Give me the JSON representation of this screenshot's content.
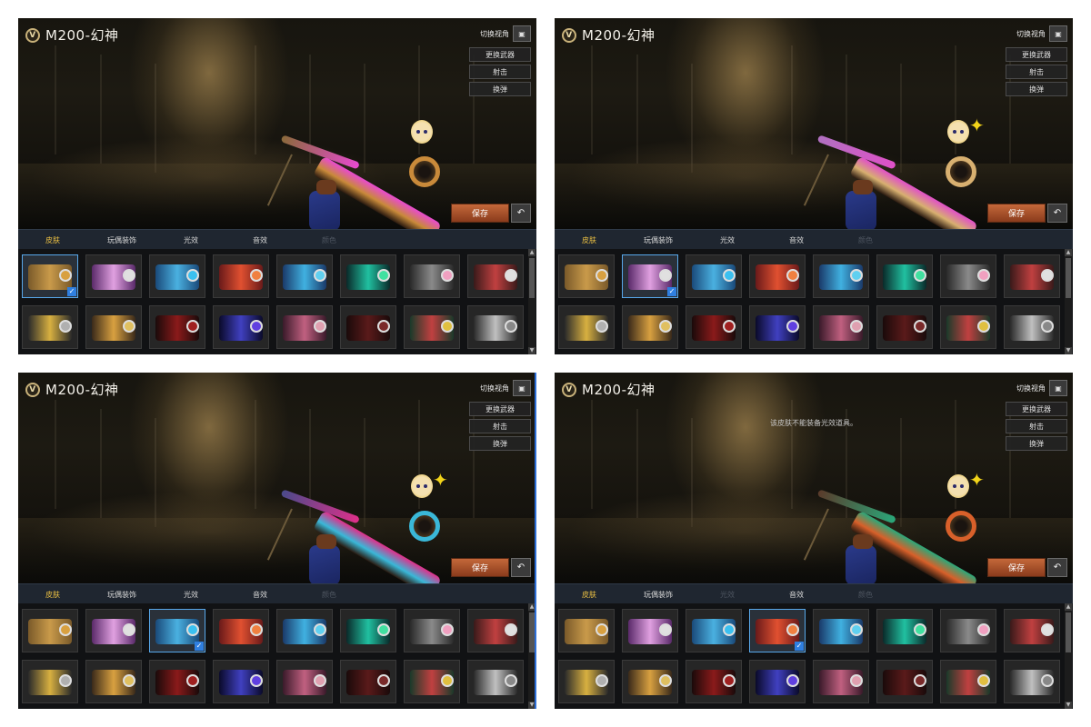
{
  "panels": [
    {
      "title": "M200-幻神",
      "camera_label": "切换视角",
      "camera_icon": "camera-icon",
      "actions": [
        "更换武器",
        "射击",
        "换弹"
      ],
      "save_label": "保存",
      "back_icon": "return-icon",
      "notice": "",
      "tabs": [
        {
          "label": "皮肤",
          "state": "active"
        },
        {
          "label": "玩偶装饰",
          "state": "normal"
        },
        {
          "label": "光效",
          "state": "normal"
        },
        {
          "label": "音效",
          "state": "normal"
        },
        {
          "label": "颜色",
          "state": "disabled"
        }
      ],
      "selected_skin_index": 0,
      "gun_colors": {
        "body": "#c98a3a",
        "accent": "#e84ad0",
        "barrel": "#8a6a3a"
      }
    },
    {
      "title": "M200-幻神",
      "camera_label": "切换视角",
      "camera_icon": "camera-icon",
      "actions": [
        "更换武器",
        "射击",
        "换弹"
      ],
      "save_label": "保存",
      "back_icon": "return-icon",
      "notice": "",
      "tabs": [
        {
          "label": "皮肤",
          "state": "active"
        },
        {
          "label": "玩偶装饰",
          "state": "normal"
        },
        {
          "label": "光效",
          "state": "normal"
        },
        {
          "label": "音效",
          "state": "normal"
        },
        {
          "label": "颜色",
          "state": "disabled"
        }
      ],
      "selected_skin_index": 1,
      "gun_colors": {
        "body": "#d8b070",
        "accent": "#e050c8",
        "barrel": "#b070c0"
      }
    },
    {
      "title": "M200-幻神",
      "camera_label": "切换视角",
      "camera_icon": "camera-icon",
      "actions": [
        "更换武器",
        "射击",
        "换弹"
      ],
      "save_label": "保存",
      "back_icon": "return-icon",
      "notice": "",
      "tabs": [
        {
          "label": "皮肤",
          "state": "active"
        },
        {
          "label": "玩偶装饰",
          "state": "normal"
        },
        {
          "label": "光效",
          "state": "normal"
        },
        {
          "label": "音效",
          "state": "normal"
        },
        {
          "label": "颜色",
          "state": "disabled"
        }
      ],
      "selected_skin_index": 2,
      "gun_colors": {
        "body": "#3ab8d8",
        "accent": "#e0308a",
        "barrel": "#4a4a8a"
      }
    },
    {
      "title": "M200-幻神",
      "camera_label": "切换视角",
      "camera_icon": "camera-icon",
      "actions": [
        "更换武器",
        "射击",
        "换弹"
      ],
      "save_label": "保存",
      "back_icon": "return-icon",
      "notice": "该皮肤不能装备光效道具。",
      "tabs": [
        {
          "label": "皮肤",
          "state": "active"
        },
        {
          "label": "玩偶装饰",
          "state": "normal"
        },
        {
          "label": "光效",
          "state": "disabled"
        },
        {
          "label": "音效",
          "state": "normal"
        },
        {
          "label": "颜色",
          "state": "disabled"
        }
      ],
      "selected_skin_index": 3,
      "gun_colors": {
        "body": "#d8602a",
        "accent": "#2aa87a",
        "barrel": "#5a3a2a"
      }
    }
  ],
  "skins": [
    {
      "art": [
        "#7a5a2a",
        "#c99a4a"
      ],
      "disc": "#d8a040"
    },
    {
      "art": [
        "#5a2a6a",
        "#e0a0e0"
      ],
      "disc": "#e0e0e0"
    },
    {
      "art": [
        "#1a4a7a",
        "#4ab0e0"
      ],
      "disc": "#3ac0f0"
    },
    {
      "art": [
        "#6a1a1a",
        "#e05030"
      ],
      "disc": "#f08040"
    },
    {
      "art": [
        "#1a3a6a",
        "#40b0e0"
      ],
      "disc": "#60d0f0"
    },
    {
      "art": [
        "#0a2a2a",
        "#20c0a0"
      ],
      "disc": "#40e0a0"
    },
    {
      "art": [
        "#2a2a2a",
        "#8a8a8a"
      ],
      "disc": "#f0a0c0"
    },
    {
      "art": [
        "#3a1a1a",
        "#c04040"
      ],
      "disc": "#e0e0e0"
    },
    {
      "art": [
        "#2a2a2a",
        "#d8b040"
      ],
      "disc": "#b0b0b0"
    },
    {
      "art": [
        "#3a2a1a",
        "#d8a040"
      ],
      "disc": "#e0c060"
    },
    {
      "art": [
        "#1a0a0a",
        "#8a1a1a"
      ],
      "disc": "#a02020"
    },
    {
      "art": [
        "#0a0a2a",
        "#4040c0"
      ],
      "disc": "#6040e0"
    },
    {
      "art": [
        "#3a1a2a",
        "#c06080"
      ],
      "disc": "#e0a0b0"
    },
    {
      "art": [
        "#1a0a0a",
        "#5a1a1a"
      ],
      "disc": "#7a2a2a"
    },
    {
      "art": [
        "#1a3a2a",
        "#c04040"
      ],
      "disc": "#e0c040"
    },
    {
      "art": [
        "#2a2a2a",
        "#c0c0c0"
      ],
      "disc": "#888888"
    }
  ]
}
